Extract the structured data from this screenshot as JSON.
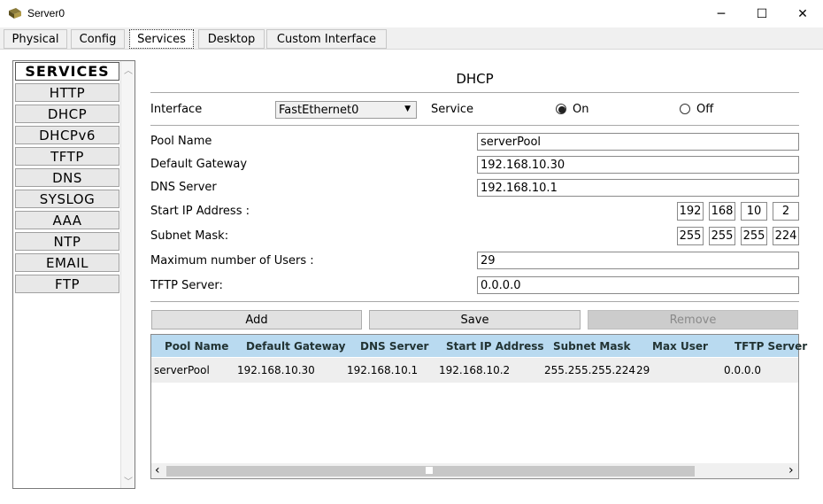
{
  "window": {
    "title": "Server0",
    "minimize": "─",
    "maximize": "☐",
    "close": "✕"
  },
  "tabs": [
    "Physical",
    "Config",
    "Services",
    "Desktop",
    "Custom Interface"
  ],
  "sidebar": {
    "header": "SERVICES",
    "items": [
      "HTTP",
      "DHCP",
      "DHCPv6",
      "TFTP",
      "DNS",
      "SYSLOG",
      "AAA",
      "NTP",
      "EMAIL",
      "FTP"
    ]
  },
  "panel": {
    "title": "DHCP",
    "interface_label": "Interface",
    "interface_value": "FastEthernet0",
    "service_label": "Service",
    "on_label": "On",
    "off_label": "Off",
    "pool_name_label": "Pool Name",
    "pool_name": "serverPool",
    "gateway_label": "Default Gateway",
    "gateway": "192.168.10.30",
    "dns_label": "DNS Server",
    "dns": "192.168.10.1",
    "start_ip_label": "Start IP Address :",
    "start_ip": [
      "192",
      "168",
      "10",
      "2"
    ],
    "subnet_label": "Subnet Mask:",
    "subnet": [
      "255",
      "255",
      "255",
      "224"
    ],
    "max_users_label": "Maximum number of Users :",
    "max_users": "29",
    "tftp_label": "TFTP Server:",
    "tftp": "0.0.0.0",
    "add_label": "Add",
    "save_label": "Save",
    "remove_label": "Remove"
  },
  "table": {
    "columns": [
      "Pool Name",
      "Default Gateway",
      "DNS Server",
      "Start IP Address",
      "Subnet Mask",
      "Max User",
      "TFTP Server"
    ],
    "rows": [
      [
        "serverPool",
        "192.168.10.30",
        "192.168.10.1",
        "192.168.10.2",
        "255.255.255.224",
        "29",
        "0.0.0.0"
      ]
    ],
    "scroll_left": "‹",
    "scroll_right": "›"
  },
  "colors": {
    "table_header": "#b9daf0",
    "row_bg": "#eeeeee"
  }
}
